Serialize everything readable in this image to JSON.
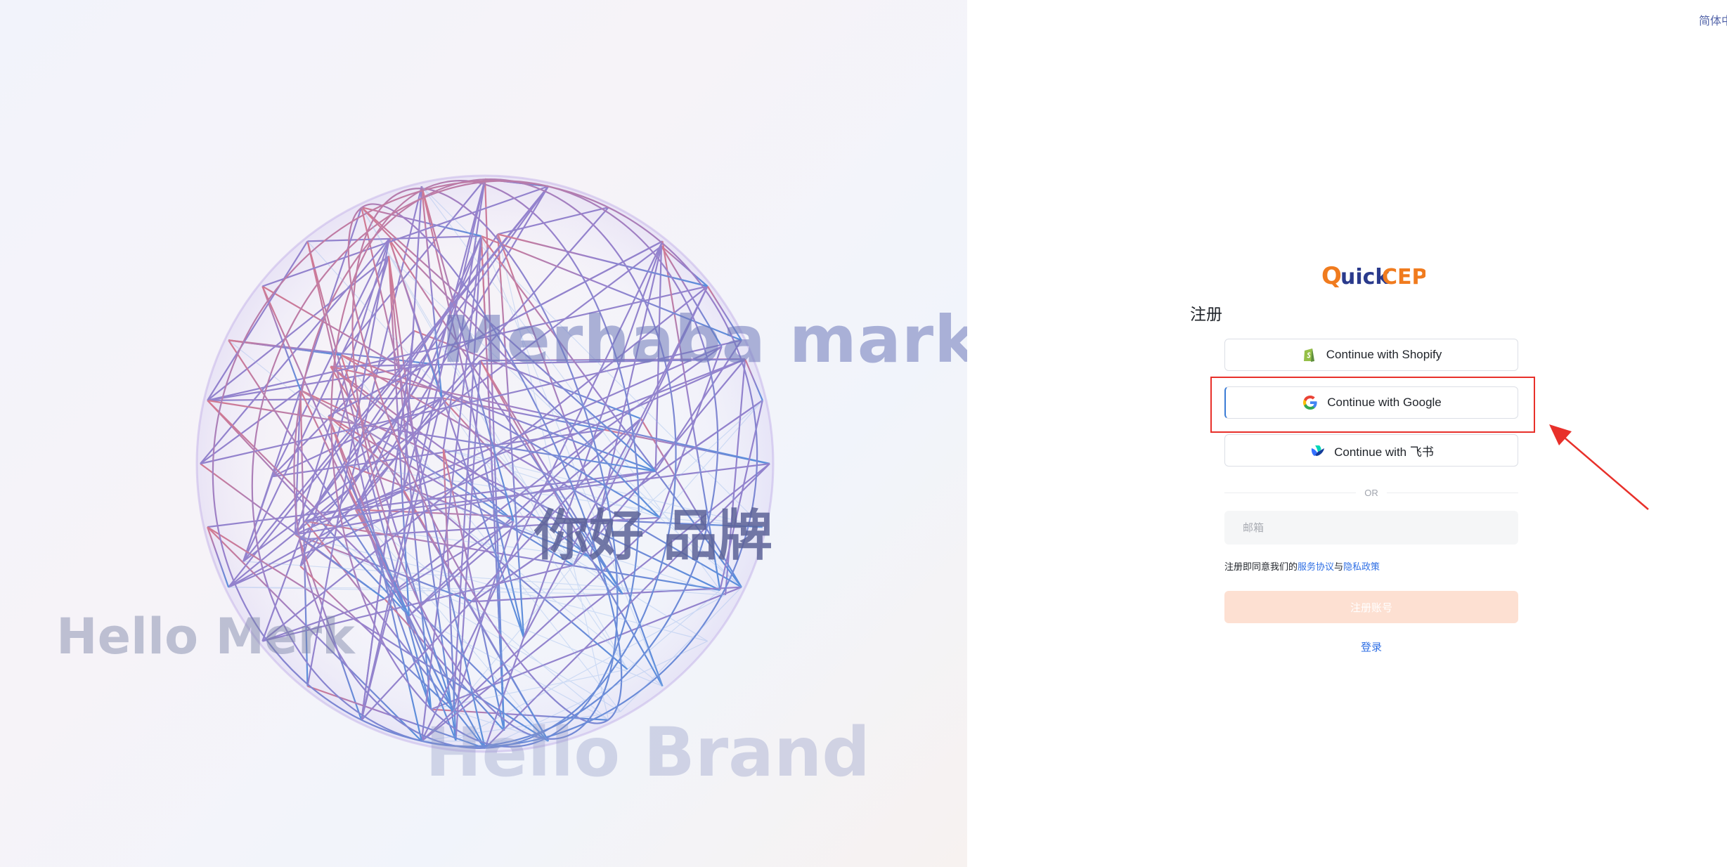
{
  "language": {
    "label": "简体中文"
  },
  "hero": {
    "phrases": {
      "merhaba": "Merhaba marka",
      "nihao": "你好 品牌",
      "hello_merk": "Hello Merk",
      "hello_brand": "Hello Brand"
    }
  },
  "brand": {
    "logo_text_q": "Q",
    "logo_text_uick": "uick",
    "logo_text_cep": "CEP",
    "primary_color": "#f07b1e",
    "secondary_color": "#2a3a8c"
  },
  "form": {
    "title": "注册",
    "oauth": {
      "shopify": {
        "label": "Continue with Shopify",
        "icon": "shopify-icon"
      },
      "google": {
        "label": "Continue with Google",
        "icon": "google-icon"
      },
      "feishu": {
        "label": "Continue with 飞书",
        "icon": "feishu-icon"
      }
    },
    "divider_text": "OR",
    "email_placeholder": "邮箱",
    "agreement": {
      "prefix": "注册即同意我们的",
      "terms": "服务协议",
      "conjunction": "与",
      "privacy": "隐私政策"
    },
    "submit_label": "注册账号",
    "login_label": "登录"
  },
  "annotation": {
    "highlight_color": "#e8302a",
    "target": "google-oauth-button"
  }
}
